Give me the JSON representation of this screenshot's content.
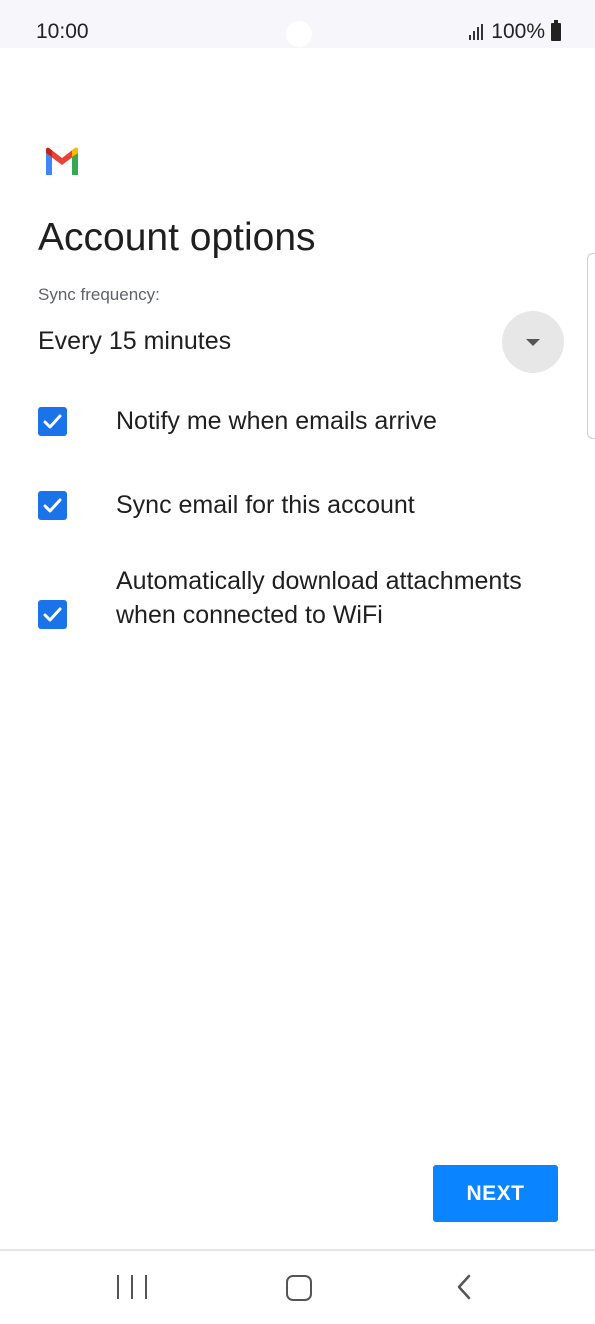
{
  "status_bar": {
    "time": "10:00",
    "battery": "100%",
    "icons": [
      "signal-icon",
      "battery-icon"
    ]
  },
  "app": {
    "logo": "gmail-logo",
    "title": "Account options"
  },
  "sync": {
    "label": "Sync frequency:",
    "value": "Every 15 minutes",
    "dropdown_icon": "chevron-down-icon"
  },
  "options": [
    {
      "label": "Notify me when emails arrive",
      "checked": true
    },
    {
      "label": "Sync email for this account",
      "checked": true
    },
    {
      "label": "Automatically download attachments when connected to WiFi",
      "checked": true
    }
  ],
  "next_button": {
    "label": "NEXT",
    "color": "#0a84ff"
  },
  "nav_bar": {
    "icons": [
      "recents-icon",
      "home-icon",
      "back-icon"
    ]
  },
  "colors": {
    "checkbox": "#1a73e8",
    "status_bar_bg": "#f6f6fb"
  }
}
